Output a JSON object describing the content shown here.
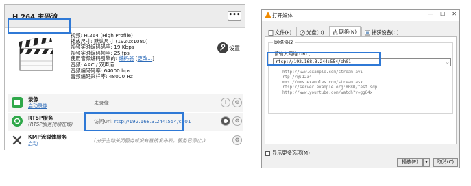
{
  "left_panel": {
    "title": "H.264 主码流",
    "more_label": "•••",
    "info": {
      "video_k": "视频:",
      "video_v": "H.264 (High Profile)",
      "size_k": "播放尺寸:",
      "size_v": "默认尺寸 (1920x1080)",
      "vbitrate_k": "视频实时编码码率:",
      "vbitrate_v": "19 Kbps",
      "vfps_k": "视频实时编码帧率:",
      "vfps_v": "25 fps",
      "aengine_k": "使用音频编码引擎的:",
      "aengine_link": "编码器",
      "aengine_sep": "[",
      "aengine_change": "更改...",
      "aengine_end": "]",
      "audio_k": "音频:",
      "audio_v": "AAC / 双声道",
      "abitrate_k": "音频编码码率:",
      "abitrate_v": "64000 bps",
      "asample_k": "音频编码采样率:",
      "asample_v": "48000 Hz"
    },
    "settings_label": "设置",
    "services": [
      {
        "name": "录像",
        "sub": "启动录像",
        "status": "未录像"
      },
      {
        "name": "RTSP服务",
        "sub": "(RTSP服务持续在线)",
        "status_label": "访问Url:",
        "status_url": "rtsp://192.168.3.244:554/ch01"
      },
      {
        "name": "KMP流媒体服务",
        "sub": "启动",
        "note": "(由于主动关闭服务或没有直接发布表，服务已停止。)"
      }
    ]
  },
  "dialog": {
    "title": "打开媒体",
    "win_min": "—",
    "win_max": "☐",
    "win_close": "✕",
    "tabs": [
      "文件(F)",
      "光盘(D)",
      "网络(N)",
      "捕获设备(C)"
    ],
    "group_label": "网络协议",
    "url_label": "请输入网络 URL：",
    "url_value": "rtsp://192.168.3.244:554/ch01",
    "examples": [
      "http://www.example.com/stream.avi",
      "rtp://@:1234",
      "mms://mms.examples.com/stream.asx",
      "rtsp://server.example.org:8080/test.sdp",
      "http://www.yourtube.com/watch?v=gg64x"
    ],
    "show_more": "显示更多选项(M)",
    "play_label": "播放(P)",
    "play_arrow": "▾",
    "cancel_label": "取消(C)"
  },
  "colors": {
    "highlight": "#2f79d6",
    "link": "#2d6bb8",
    "vlc_orange": "#f08a00"
  }
}
